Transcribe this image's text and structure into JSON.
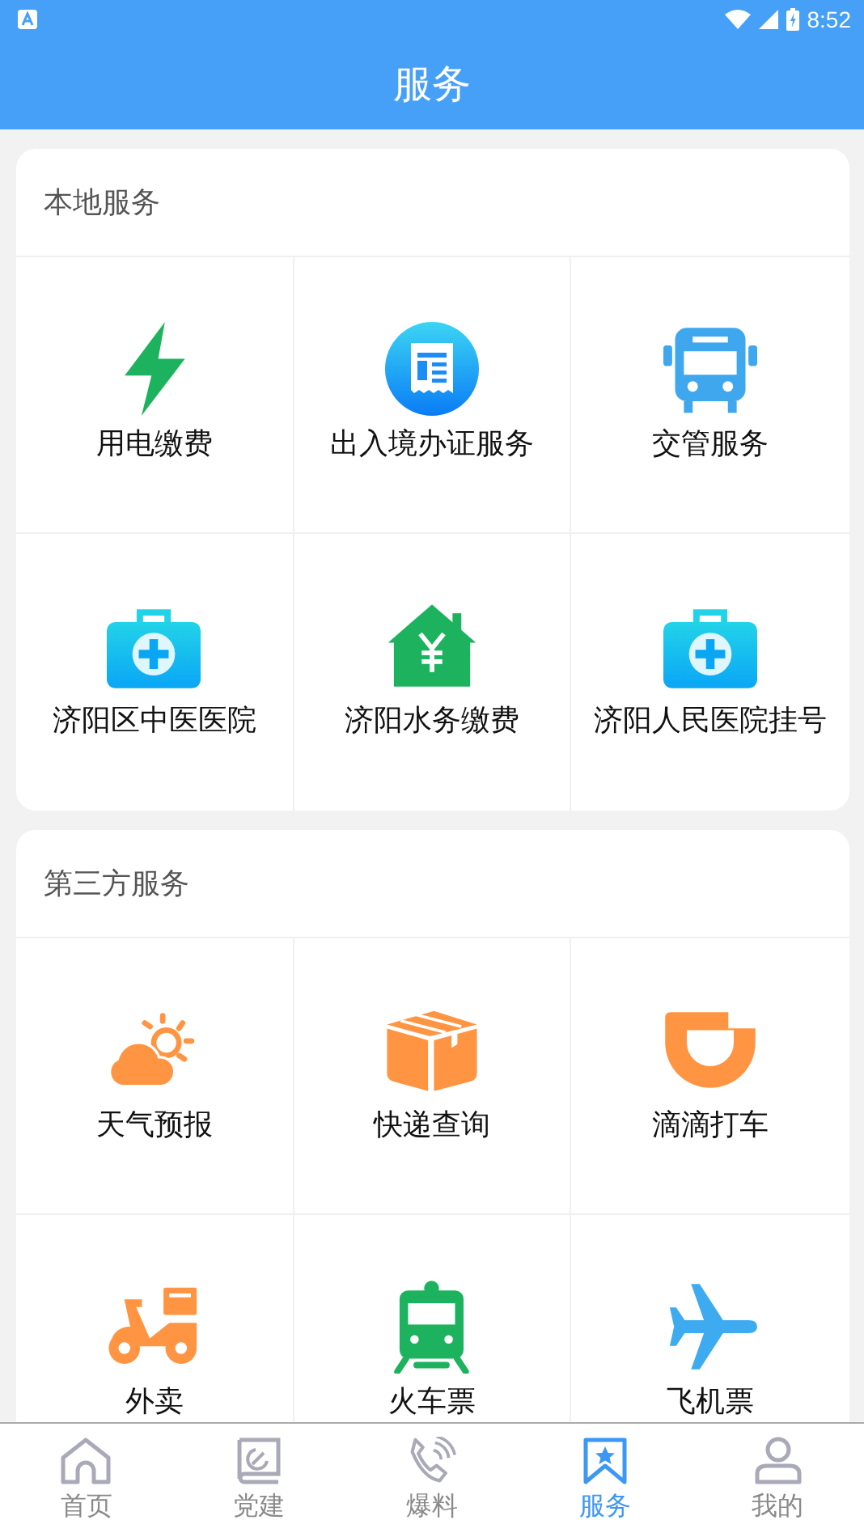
{
  "status_bar": {
    "time": "8:52"
  },
  "header": {
    "title": "服务"
  },
  "sections": [
    {
      "title": "本地服务",
      "items": [
        {
          "label": "用电缴费"
        },
        {
          "label": "出入境办证服务"
        },
        {
          "label": "交管服务"
        },
        {
          "label": "济阳区中医医院"
        },
        {
          "label": "济阳水务缴费"
        },
        {
          "label": "济阳人民医院挂号"
        }
      ]
    },
    {
      "title": "第三方服务",
      "items": [
        {
          "label": "天气预报"
        },
        {
          "label": "快递查询"
        },
        {
          "label": "滴滴打车"
        },
        {
          "label": "外卖"
        },
        {
          "label": "火车票"
        },
        {
          "label": "飞机票"
        }
      ]
    }
  ],
  "tab_bar": [
    {
      "label": "首页",
      "selected": false
    },
    {
      "label": "党建",
      "selected": false
    },
    {
      "label": "爆料",
      "selected": false
    },
    {
      "label": "服务",
      "selected": true
    },
    {
      "label": "我的",
      "selected": false
    }
  ]
}
